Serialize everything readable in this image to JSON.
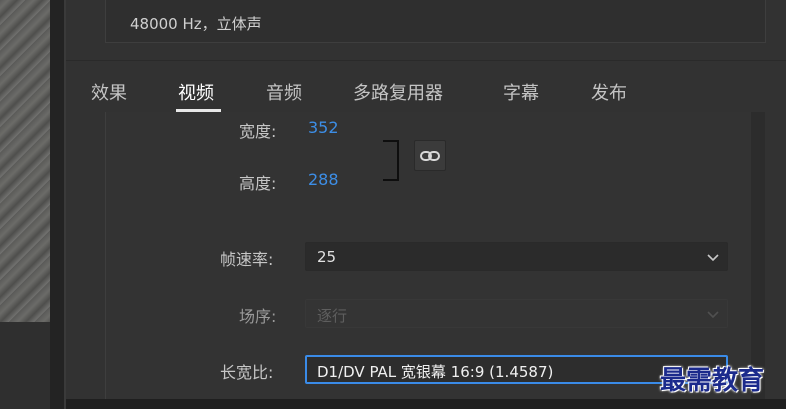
{
  "summary": {
    "audio_line": "48000 Hz，立体声"
  },
  "tabs": [
    {
      "label": "效果"
    },
    {
      "label": "视频"
    },
    {
      "label": "音频"
    },
    {
      "label": "多路复用器"
    },
    {
      "label": "字幕"
    },
    {
      "label": "发布"
    }
  ],
  "active_tab": "视频",
  "video": {
    "width_label": "宽度:",
    "width_value": "352",
    "height_label": "高度:",
    "height_value": "288",
    "frame_rate_label": "帧速率:",
    "frame_rate_value": "25",
    "field_order_label": "场序:",
    "field_order_value": "逐行",
    "aspect_label": "长宽比:",
    "aspect_value": "D1/DV PAL 宽银幕 16:9 (1.4587)"
  },
  "watermark": "最需教育",
  "colors": {
    "link_value": "#3d8ee6",
    "focus_border": "#3a8be8",
    "watermark": "#1b2a8c"
  },
  "icons": {
    "link": "chain-link-icon",
    "dropdown": "chevron-down-icon"
  }
}
